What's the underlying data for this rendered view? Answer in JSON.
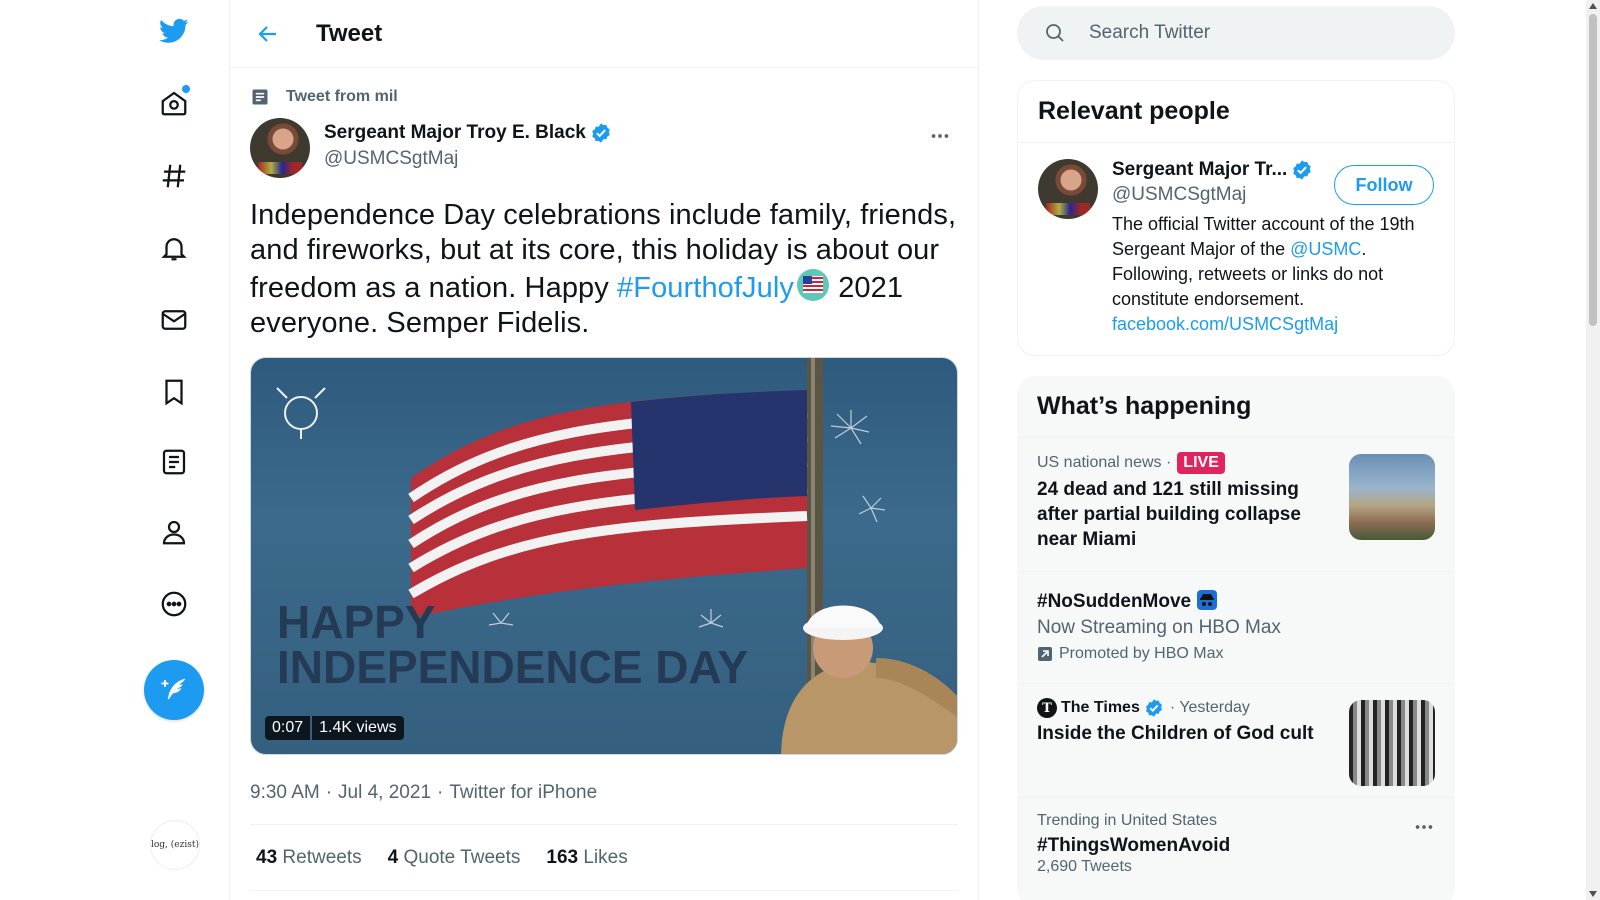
{
  "colors": {
    "accent": "#1d9bf0",
    "live": "#e0245e",
    "secondary_text": "#536471"
  },
  "nav": {
    "items": [
      {
        "icon": "twitter-logo-icon"
      },
      {
        "icon": "home-icon",
        "has_dot": true
      },
      {
        "icon": "explore-hashtag-icon"
      },
      {
        "icon": "notifications-bell-icon"
      },
      {
        "icon": "messages-envelope-icon"
      },
      {
        "icon": "bookmarks-icon"
      },
      {
        "icon": "lists-icon"
      },
      {
        "icon": "profile-icon"
      },
      {
        "icon": "more-icon"
      }
    ],
    "account_avatar_text": "log, (ezist)"
  },
  "header": {
    "title": "Tweet"
  },
  "tweet": {
    "context": "Tweet from mil",
    "author_name": "Sergeant Major Troy E. Black",
    "author_handle": "@USMCSgtMaj",
    "text_part1": "Independence Day celebrations include family, friends, and fireworks, but at its core, this holiday is about our freedom as a nation. Happy ",
    "hashtag": "#FourthofJuly",
    "text_part2": " 2021 everyone. Semper Fidelis.",
    "media": {
      "overlay_text_line1": "HAPPY",
      "overlay_text_line2": "INDEPENDENCE DAY",
      "duration": "0:07",
      "views": "1.4K views"
    },
    "time": "9:30 AM",
    "date": "Jul 4, 2021",
    "source": "Twitter for iPhone",
    "separator": "·",
    "retweets_count": "43",
    "retweets_label": "Retweets",
    "quotes_count": "4",
    "quotes_label": "Quote Tweets",
    "likes_count": "163",
    "likes_label": "Likes"
  },
  "search": {
    "placeholder": "Search Twitter"
  },
  "relevant_people": {
    "title": "Relevant people",
    "name": "Sergeant Major Tr...",
    "handle": "@USMCSgtMaj",
    "follow_label": "Follow",
    "bio_part1": "The official Twitter account of the 19th Sergeant Major of the ",
    "bio_mention": "@USMC",
    "bio_part2": ". Following, retweets or links do not constitute endorsement.",
    "bio_link": "facebook.com/USMCSgtMaj"
  },
  "happening": {
    "title": "What’s happening",
    "trends": [
      {
        "meta": "US national news ·",
        "badge": "LIVE",
        "title": "24 dead and 121 still missing after partial building collapse near Miami"
      },
      {
        "title": "#NoSuddenMove",
        "subtitle": "Now Streaming on HBO Max",
        "promo": "Promoted by HBO Max"
      },
      {
        "source": "The Times",
        "meta": "· Yesterday",
        "title": "Inside the Children of God cult"
      },
      {
        "meta": "Trending in United States",
        "title": "#ThingsWomenAvoid",
        "count": "2,690 Tweets"
      }
    ]
  }
}
